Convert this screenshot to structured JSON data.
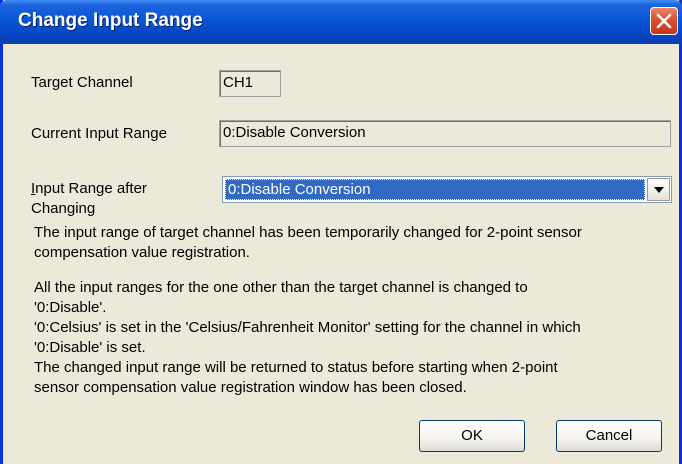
{
  "window": {
    "title": "Change Input Range"
  },
  "fields": {
    "target_channel_label": "Target Channel",
    "target_channel_value": "CH1",
    "current_range_label": "Current Input Range",
    "current_range_value": "0:Disable Conversion",
    "after_label_underlined_char": "I",
    "after_label_rest_line1": "nput Range after",
    "after_label_line2": "Changing",
    "after_range_value": "0:Disable Conversion"
  },
  "messages": {
    "temporary_change": "The input range of target channel has been temporarily changed for 2-point sensor\ncompensation value registration.",
    "details": "All the input ranges for the one other than the target channel is changed to\n'0:Disable'.\n'0:Celsius' is set in the 'Celsius/Fahrenheit Monitor' setting for the channel in which\n'0:Disable' is set.\nThe changed input range will be returned to status before starting when 2-point\nsensor compensation value registration window has been closed."
  },
  "buttons": {
    "ok": "OK",
    "cancel": "Cancel"
  },
  "icons": {
    "close": "close-icon",
    "dropdown": "chevron-down-icon"
  },
  "colors": {
    "titlebar": "#0a58d6",
    "close": "#d9502f",
    "selection": "#316ac5",
    "dialog_bg": "#ece9d8"
  }
}
